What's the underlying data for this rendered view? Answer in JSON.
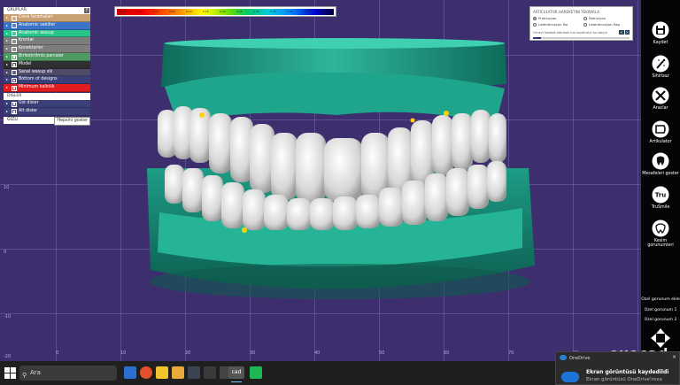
{
  "groups_panel": {
    "title": "GRUPLAR",
    "help": "?",
    "rows": [
      {
        "label": "Cene taramalari",
        "color": "#c9a074",
        "checked": false
      },
      {
        "label": "Anatomic sekiller",
        "color": "#3b73c6",
        "checked": false
      },
      {
        "label": "Anatomic wasup",
        "color": "#27c58a",
        "checked": false
      },
      {
        "label": "Kronlar",
        "color": "#7d7d7d",
        "checked": false
      },
      {
        "label": "Konektorler",
        "color": "#7d7d7d",
        "checked": false
      },
      {
        "label": "Birlestirilmis parcalar",
        "color": "#4d9a62",
        "checked": true
      },
      {
        "label": "Model",
        "color": "#2f2f2f",
        "checked": true
      },
      {
        "label": "Sanal wasup slk",
        "color": "#4e4a6a",
        "checked": false
      },
      {
        "label": "Bottom of designs",
        "color": "#3a3f78",
        "checked": true
      },
      {
        "label": "Minimum kalinlik",
        "color": "#e11c1c",
        "checked": true
      }
    ],
    "teeth_title": "DISLER",
    "teeth_rows": [
      {
        "label": "Ust disler",
        "checked": true
      },
      {
        "label": "Alt disler",
        "checked": true
      }
    ],
    "hidden_label": "GIZLI",
    "show_all_button": "Hepsini goster"
  },
  "color_scale": {
    "labels": [
      "-0.10",
      "-0.05",
      "0.00",
      "0.05",
      "0.10",
      "0.15",
      "0.20",
      "0.25",
      "0.30",
      "0.35",
      "0.40",
      "0.45",
      "0.50"
    ]
  },
  "articulator": {
    "title": "ARTICULATOR HAREKETINI TEKRARLA",
    "options": [
      {
        "label": "Protruzyon",
        "selected": true
      },
      {
        "label": "Retruzyon",
        "selected": false
      },
      {
        "label": "Laterotruzyon Sol",
        "selected": false
      },
      {
        "label": "Laterotruzyon Sag",
        "selected": false
      }
    ],
    "hint": "Ceneyi hareket ettirmek icin kaydiriciyi surukeyin",
    "nav_prev": "<",
    "nav_next": ">",
    "slider_value": 0.08
  },
  "toolbar": {
    "items": [
      {
        "name": "save-tool",
        "icon": "floppy-icon",
        "label": "Kaydet"
      },
      {
        "name": "wizard-tool",
        "icon": "magic-wand-icon",
        "label": "Sihirbaz"
      },
      {
        "name": "tools-tool",
        "icon": "wrench-hammer-icon",
        "label": "Araclar"
      },
      {
        "name": "articulator-tool",
        "icon": "articulator-icon",
        "label": "Artikulator"
      },
      {
        "name": "distances-tool",
        "icon": "tooth-distance-icon",
        "label": "Mesafeleri goster"
      },
      {
        "name": "trusmile-tool",
        "icon": "trusmile-icon",
        "label": "TruSmile"
      },
      {
        "name": "cut-views-tool",
        "icon": "tooth-section-icon",
        "label": "Kesim gorunumleri"
      }
    ],
    "views": [
      "Ozel gorunum ekle",
      "Ozel gorunum 1",
      "Ozel gorunum 2"
    ]
  },
  "brand": "exocad",
  "axis_ticks": [
    "0",
    "10",
    "20",
    "30",
    "40",
    "50",
    "60",
    "70",
    "80"
  ],
  "left_ticks": [
    "20",
    "10",
    "0",
    "-10",
    "-20"
  ],
  "taskbar": {
    "search_placeholder": "Ara",
    "apps": [
      "file-explorer-icon",
      "edge-icon",
      "mail-icon",
      "folder-icon",
      "store-icon",
      "steam-icon",
      "terminal-icon",
      "exo-icon",
      "cad-icon",
      "spotify-icon"
    ],
    "active_label": "cad"
  },
  "toast": {
    "app": "OneDrive",
    "title": "Ekran görüntüsü kaydedildi",
    "body": "Ekran görüntüsü OneDrive'ınıza",
    "close": "×"
  }
}
